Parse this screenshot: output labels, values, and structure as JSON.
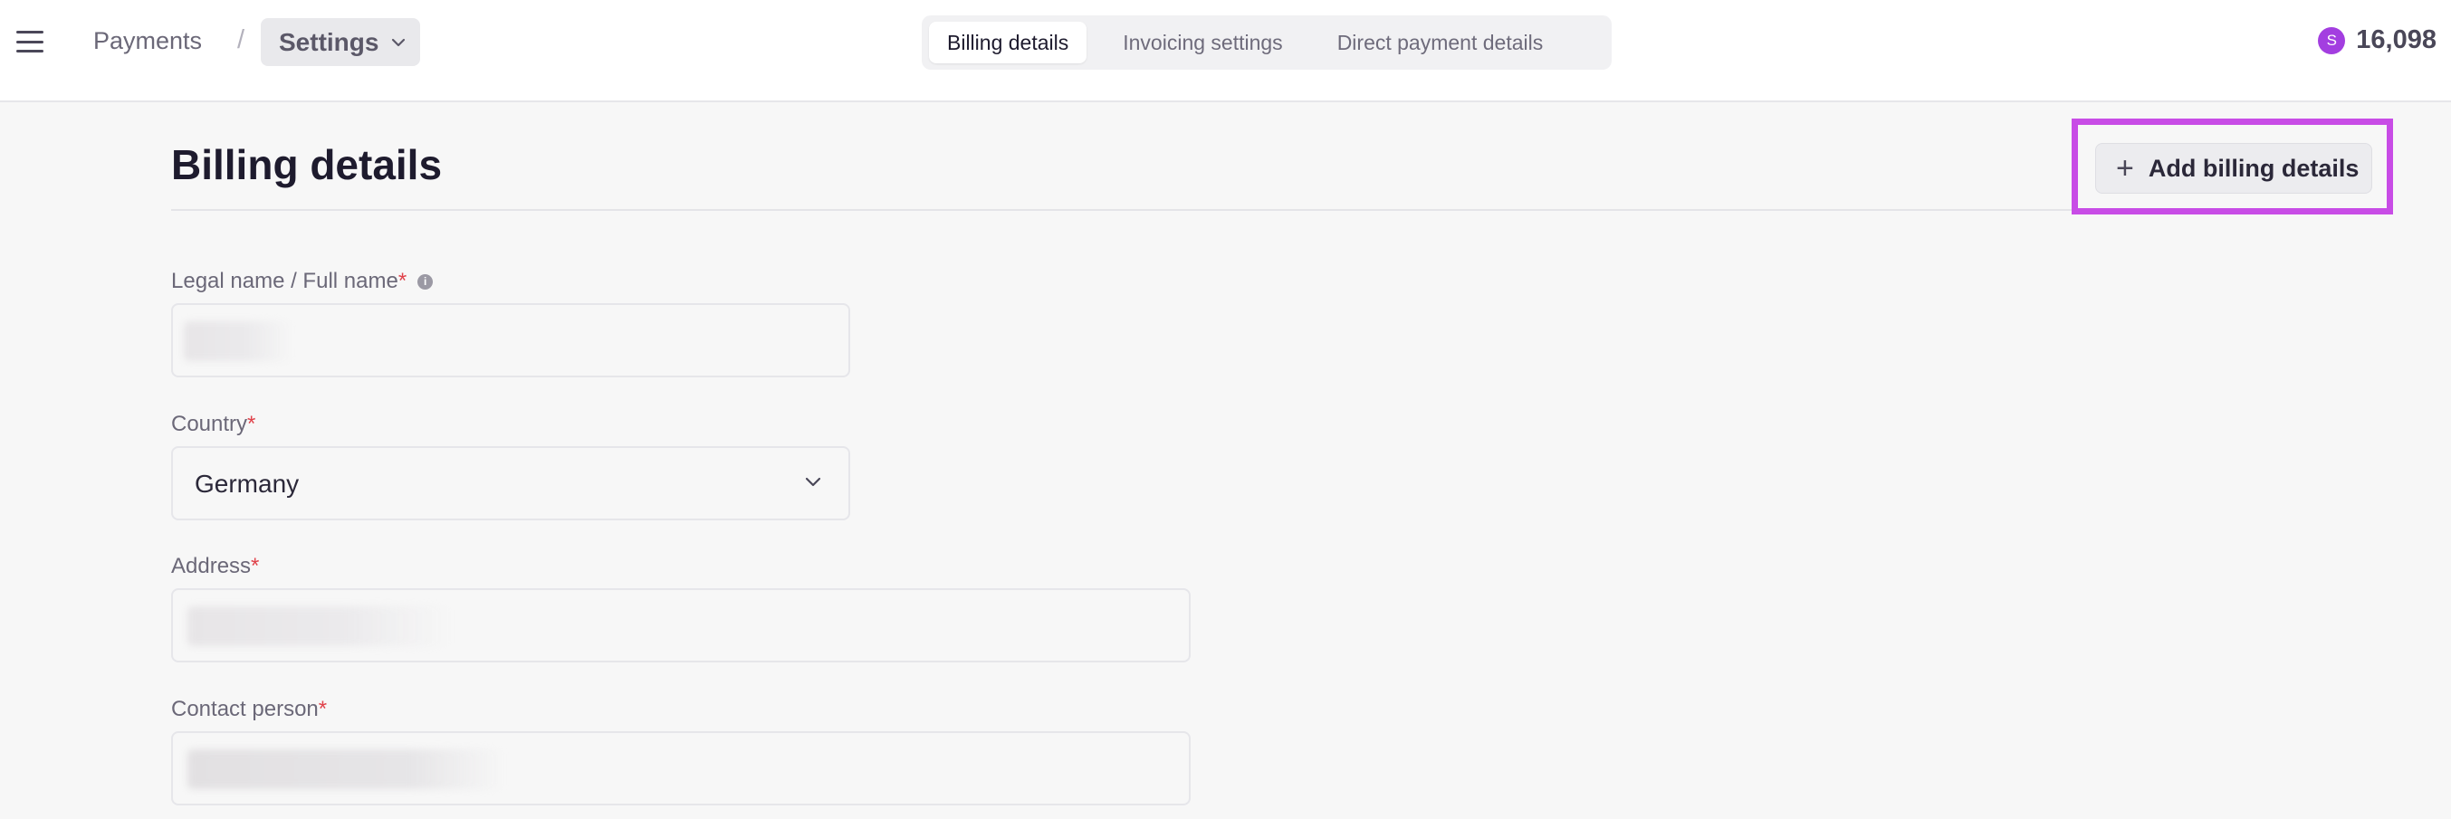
{
  "topbar": {
    "breadcrumb_root": "Payments",
    "breadcrumb_separator": "/",
    "settings_label": "Settings",
    "tabs": [
      {
        "label": "Billing details",
        "active": true
      },
      {
        "label": "Invoicing settings",
        "active": false
      },
      {
        "label": "Direct payment details",
        "active": false
      }
    ],
    "credits_coin": "S",
    "credits_value": "16,098"
  },
  "page": {
    "title": "Billing details",
    "add_button_label": "Add billing details",
    "add_button_icon": "plus-icon"
  },
  "form": {
    "legal_name": {
      "label": "Legal name / Full name",
      "required_mark": "*",
      "value": ""
    },
    "country": {
      "label": "Country",
      "required_mark": "*",
      "value": "Germany"
    },
    "address": {
      "label": "Address",
      "required_mark": "*",
      "value": ""
    },
    "contact_person": {
      "label": "Contact person",
      "required_mark": "*",
      "value": ""
    }
  },
  "colors": {
    "accent_highlight": "#c84ce6",
    "coin": "#a33ee0",
    "required": "#e0424a"
  }
}
